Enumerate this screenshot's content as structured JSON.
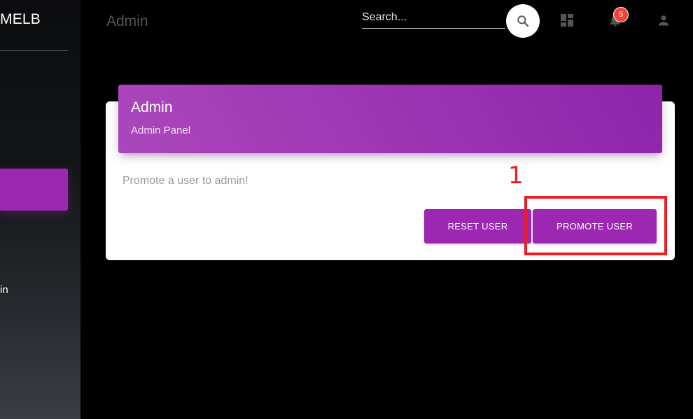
{
  "sidebar": {
    "brand": "MELB",
    "partial_item": "in"
  },
  "topbar": {
    "title": "Admin",
    "search": {
      "placeholder": "Search...",
      "value": ""
    },
    "notifications": {
      "count": "5"
    },
    "icons": {
      "search": "search-icon",
      "dashboard": "dashboard-icon",
      "notifications": "bell-icon",
      "profile": "person-icon"
    }
  },
  "card": {
    "title": "Admin",
    "subtitle": "Admin Panel",
    "text": "Promote a user to admin!",
    "reset_label": "RESET USER",
    "promote_label": "PROMOTE USER"
  },
  "annotation": {
    "label": "1",
    "color": "#ee1c25"
  },
  "colors": {
    "accent": "#9c27b0",
    "badge": "#f44336",
    "background": "#000000"
  }
}
